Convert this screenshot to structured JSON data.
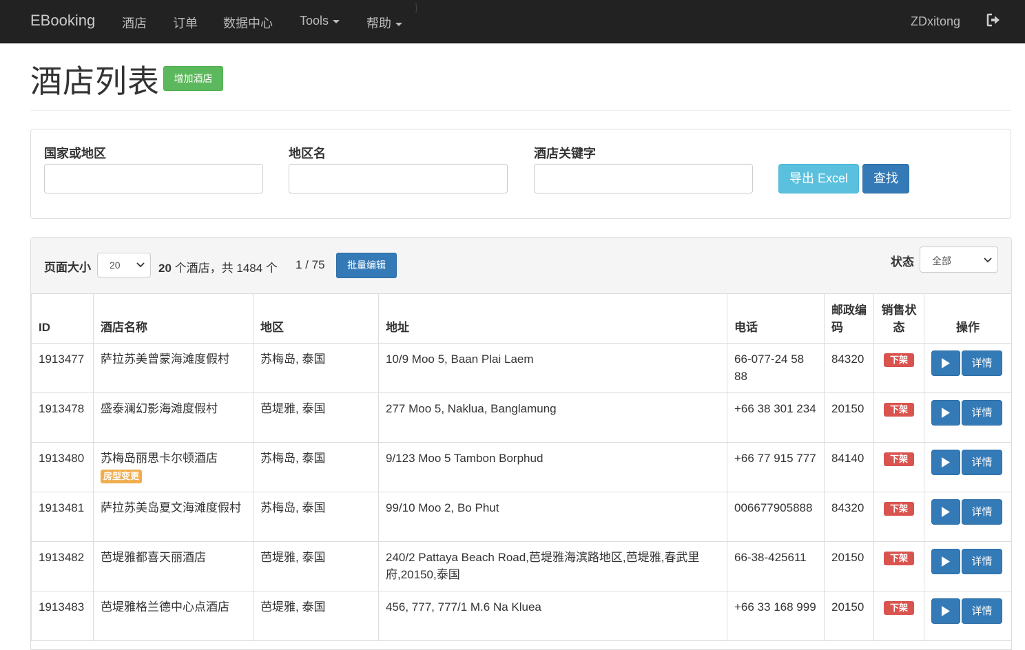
{
  "nav": {
    "brand": "EBooking",
    "items": [
      "酒店",
      "订单",
      "数据中心"
    ],
    "dropdowns": [
      "Tools",
      "帮助"
    ],
    "stray": "}",
    "user": "ZDxitong",
    "logout_icon": "logout-icon"
  },
  "header": {
    "title": "酒店列表",
    "add_button": "增加酒店"
  },
  "filters": {
    "country_label": "国家或地区",
    "region_label": "地区名",
    "keyword_label": "酒店关键字",
    "country_value": "",
    "region_value": "",
    "keyword_value": "",
    "export_button": "导出 Excel",
    "search_button": "查找"
  },
  "toolbar": {
    "page_size_label": "页面大小",
    "page_size_value": "20",
    "count_prefix": "20",
    "count_text": " 个酒店，共 1484 个",
    "page_indicator": "1 / 75",
    "batch_button": "批量编辑",
    "status_label": "状态",
    "status_value": "全部"
  },
  "table": {
    "headers": {
      "id": "ID",
      "name": "酒店名称",
      "region": "地区",
      "address": "地址",
      "phone": "电话",
      "postal": "邮政编码",
      "sale_status": "销售状态",
      "ops": "操作"
    },
    "detail_label": "详情",
    "rows": [
      {
        "id": "1913477",
        "name": "萨拉苏美曾蒙海滩度假村",
        "tag": "",
        "region": "苏梅岛, 泰国",
        "address": "10/9 Moo 5, Baan Plai Laem",
        "phone": "66-077-24 58 88",
        "postal": "84320",
        "status": "下架"
      },
      {
        "id": "1913478",
        "name": "盛泰澜幻影海滩度假村",
        "tag": "",
        "region": "芭堤雅, 泰国",
        "address": "277 Moo 5, Naklua, Banglamung",
        "phone": "+66 38 301 234",
        "postal": "20150",
        "status": "下架"
      },
      {
        "id": "1913480",
        "name": "苏梅岛丽思卡尔顿酒店",
        "tag": "房型变更",
        "region": "苏梅岛, 泰国",
        "address": "9/123 Moo 5 Tambon Borphud",
        "phone": "+66 77 915 777",
        "postal": "84140",
        "status": "下架"
      },
      {
        "id": "1913481",
        "name": "萨拉苏美岛夏文海滩度假村",
        "tag": "",
        "region": "苏梅岛, 泰国",
        "address": "99/10 Moo 2, Bo Phut",
        "phone": "006677905888",
        "postal": "84320",
        "status": "下架"
      },
      {
        "id": "1913482",
        "name": "芭堤雅都喜天丽酒店",
        "tag": "",
        "region": "芭堤雅, 泰国",
        "address": "240/2 Pattaya Beach Road,芭堤雅海滨路地区,芭堤雅,春武里府,20150,泰国",
        "phone": "66-38-425611",
        "postal": "20150",
        "status": "下架"
      },
      {
        "id": "1913483",
        "name": "芭堤雅格兰德中心点酒店",
        "tag": "",
        "region": "芭堤雅, 泰国",
        "address": "456, 777, 777/1 M.6 Na Kluea",
        "phone": "+66 33 168 999",
        "postal": "20150",
        "status": "下架"
      }
    ]
  }
}
